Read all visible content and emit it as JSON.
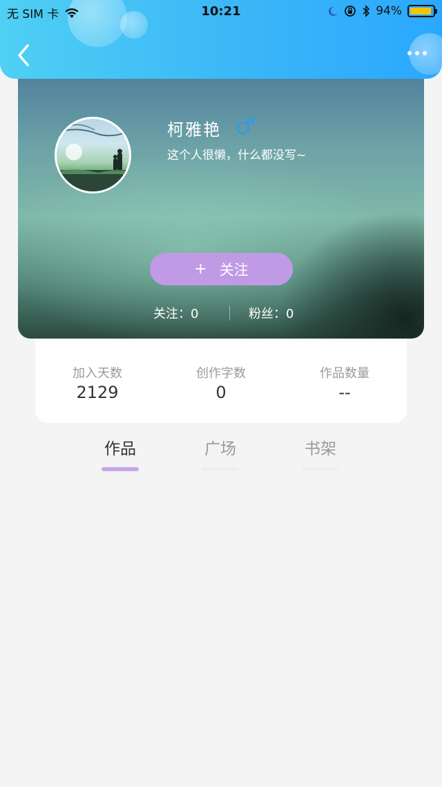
{
  "status_bar": {
    "carrier": "无 SIM 卡",
    "time": "10:21",
    "battery_percent": "94%",
    "battery_level": 0.94
  },
  "profile": {
    "name": "柯雅艳",
    "bio": "这个人很懒，什么都没写~",
    "gender_icon": "male-symbol-icon",
    "follow_button": {
      "plus": "+",
      "label": "关注"
    },
    "following": "关注：0",
    "fans": "粉丝：0"
  },
  "info": {
    "items": [
      {
        "label": "加入天数",
        "value": "2129"
      },
      {
        "label": "创作字数",
        "value": "0"
      },
      {
        "label": "作品数量",
        "value": "--"
      }
    ]
  },
  "tabs": [
    {
      "label": "作品",
      "active": true
    },
    {
      "label": "广场",
      "active": false
    },
    {
      "label": "书架",
      "active": false
    }
  ],
  "colors": {
    "header_gradient_start": "#4fd0f4",
    "header_gradient_end": "#2aa8ff",
    "follow_button": "#c19ae6",
    "active_tab_underline": "#c6a8e8",
    "gender_icon": "#2f9be6"
  }
}
